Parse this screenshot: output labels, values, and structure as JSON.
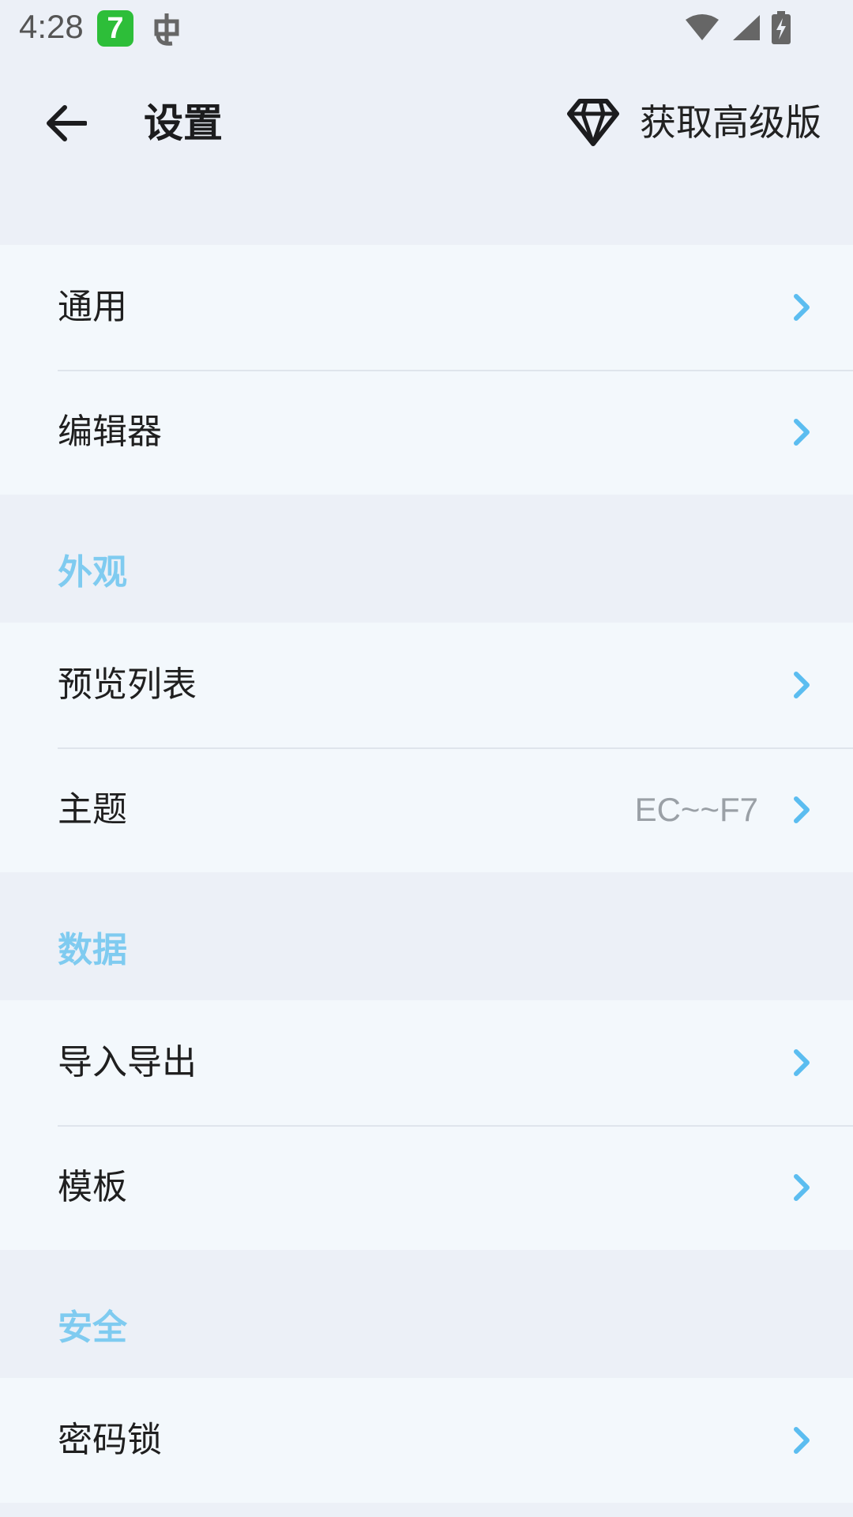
{
  "status_bar": {
    "time": "4:28",
    "app_icon_glyph": "7",
    "app_icon_color": "#2DBE39"
  },
  "app_bar": {
    "title": "设置",
    "premium_label": "获取高级版"
  },
  "group_general": {
    "items": [
      {
        "label": "通用"
      },
      {
        "label": "编辑器"
      }
    ]
  },
  "section_appearance": {
    "title": "外观",
    "items": [
      {
        "label": "预览列表"
      },
      {
        "label": "主题",
        "value": "EC~~F7"
      }
    ]
  },
  "section_data": {
    "title": "数据",
    "items": [
      {
        "label": "导入导出"
      },
      {
        "label": "模板"
      }
    ]
  },
  "section_security": {
    "title": "安全",
    "items": [
      {
        "label": "密码锁"
      }
    ]
  },
  "colors": {
    "background": "#ECF0F7",
    "row_background": "#F3F8FC",
    "accent": "#7FCBF0",
    "chevron": "#5BBDF0"
  }
}
